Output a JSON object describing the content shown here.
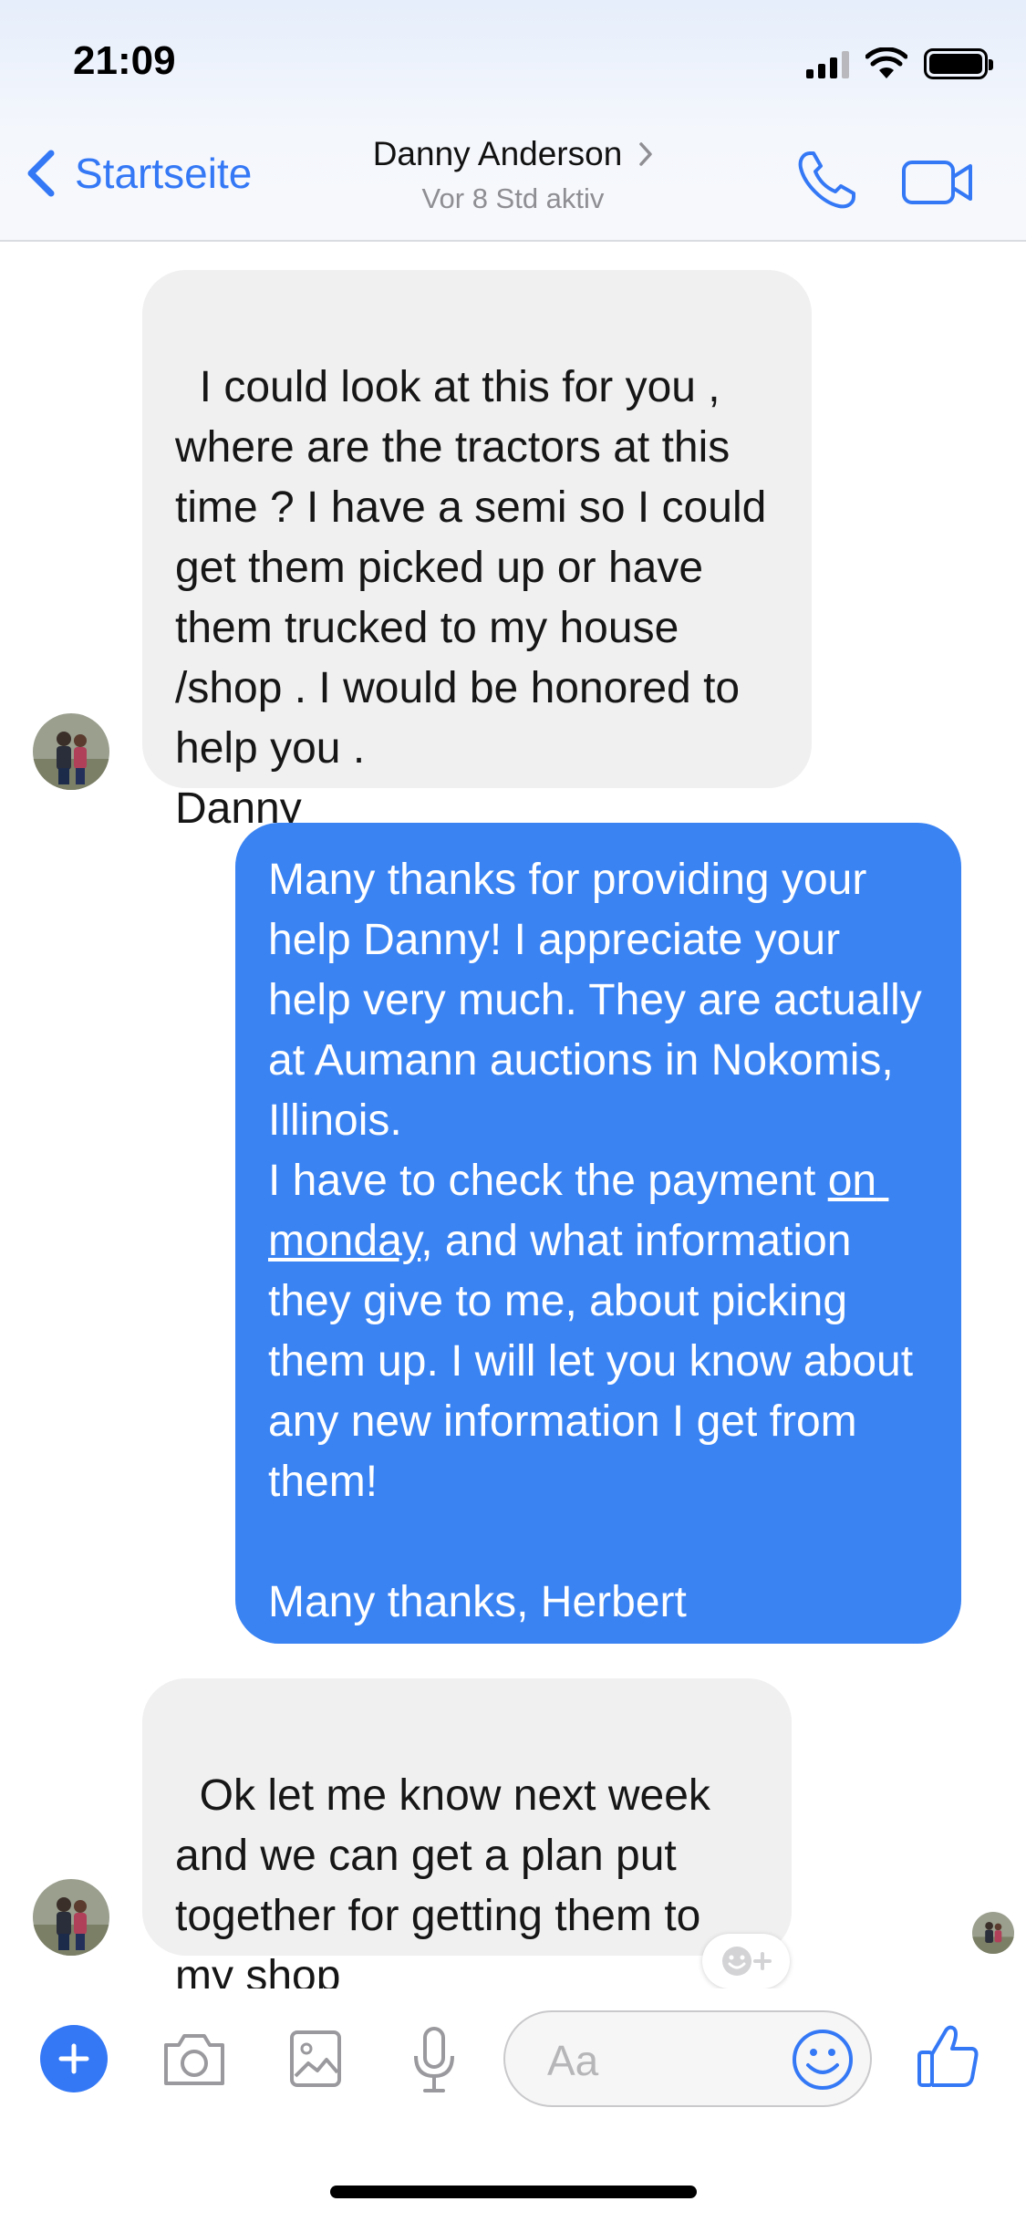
{
  "status_bar": {
    "time": "21:09"
  },
  "nav": {
    "back_label": "Startseite",
    "contact_name": "Danny Anderson",
    "contact_status": "Vor 8 Std aktiv"
  },
  "messages": [
    {
      "sender": "Danny Anderson",
      "direction": "incoming",
      "text": "I could look at this for you , where are the tractors at this time ? I have a semi so I could get them picked up or have them trucked to my house /shop . I would be honored to help you .\nDanny"
    },
    {
      "sender": "Herbert",
      "direction": "outgoing",
      "text_part1": "Many thanks for providing your help Danny! I appreciate your help very much. They are actually at Aumann auctions in Nokomis, Illinois.\nI have to check the payment ",
      "link_text": "on monday",
      "text_part2": ", and what information they give to me, about picking them up. I will let you know about any new information I get from them!\n\nMany thanks, Herbert"
    },
    {
      "sender": "Danny Anderson",
      "direction": "incoming",
      "text": "Ok let me know next week and we can get a plan put together for getting them to my shop"
    }
  ],
  "composer": {
    "placeholder": "Aa"
  },
  "colors": {
    "accent": "#3478f6",
    "outgoing_bubble": "#3a83f3",
    "incoming_bubble": "#f0f0f0"
  },
  "icons": [
    "back-chevron-icon",
    "phone-icon",
    "video-camera-icon",
    "plus-icon",
    "camera-icon",
    "image-icon",
    "microphone-icon",
    "emoji-icon",
    "thumbs-up-icon",
    "add-reaction-icon"
  ]
}
